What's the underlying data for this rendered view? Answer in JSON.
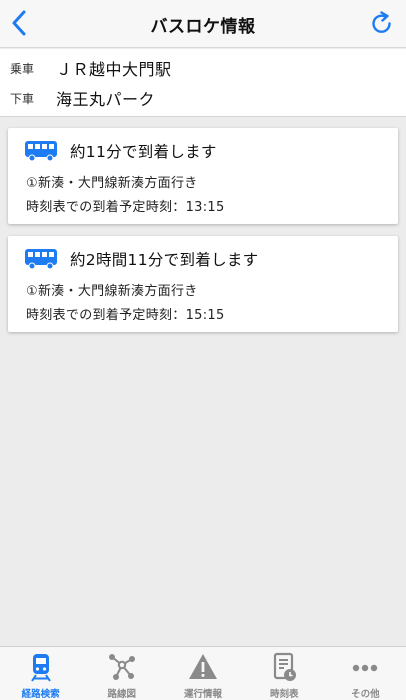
{
  "header": {
    "title": "バスロケ情報",
    "back_icon": "chevron-left-icon",
    "refresh_icon": "refresh-icon",
    "accent": "#1d7cf2"
  },
  "stops": {
    "board_label": "乗車",
    "board_value": "ＪＲ越中大門駅",
    "alight_label": "下車",
    "alight_value": "海王丸パーク"
  },
  "buses": [
    {
      "icon": "bus-icon",
      "arrival": "約11分で到着します",
      "route": "①新湊・大門線新湊方面行き",
      "scheduled": "時刻表での到着予定時刻：13:15"
    },
    {
      "icon": "bus-icon",
      "arrival": "約2時間11分で到着します",
      "route": "①新湊・大門線新湊方面行き",
      "scheduled": "時刻表での到着予定時刻：15:15"
    }
  ],
  "tabbar": {
    "items": [
      {
        "label": "経路検索",
        "icon": "train-icon",
        "active": true
      },
      {
        "label": "路線図",
        "icon": "route-map-icon",
        "active": false
      },
      {
        "label": "運行情報",
        "icon": "warning-icon",
        "active": false
      },
      {
        "label": "時刻表",
        "icon": "timetable-icon",
        "active": false
      },
      {
        "label": "その他",
        "icon": "more-icon",
        "active": false
      }
    ],
    "active_color": "#1d7cf2",
    "inactive_color": "#8a8a8a"
  }
}
